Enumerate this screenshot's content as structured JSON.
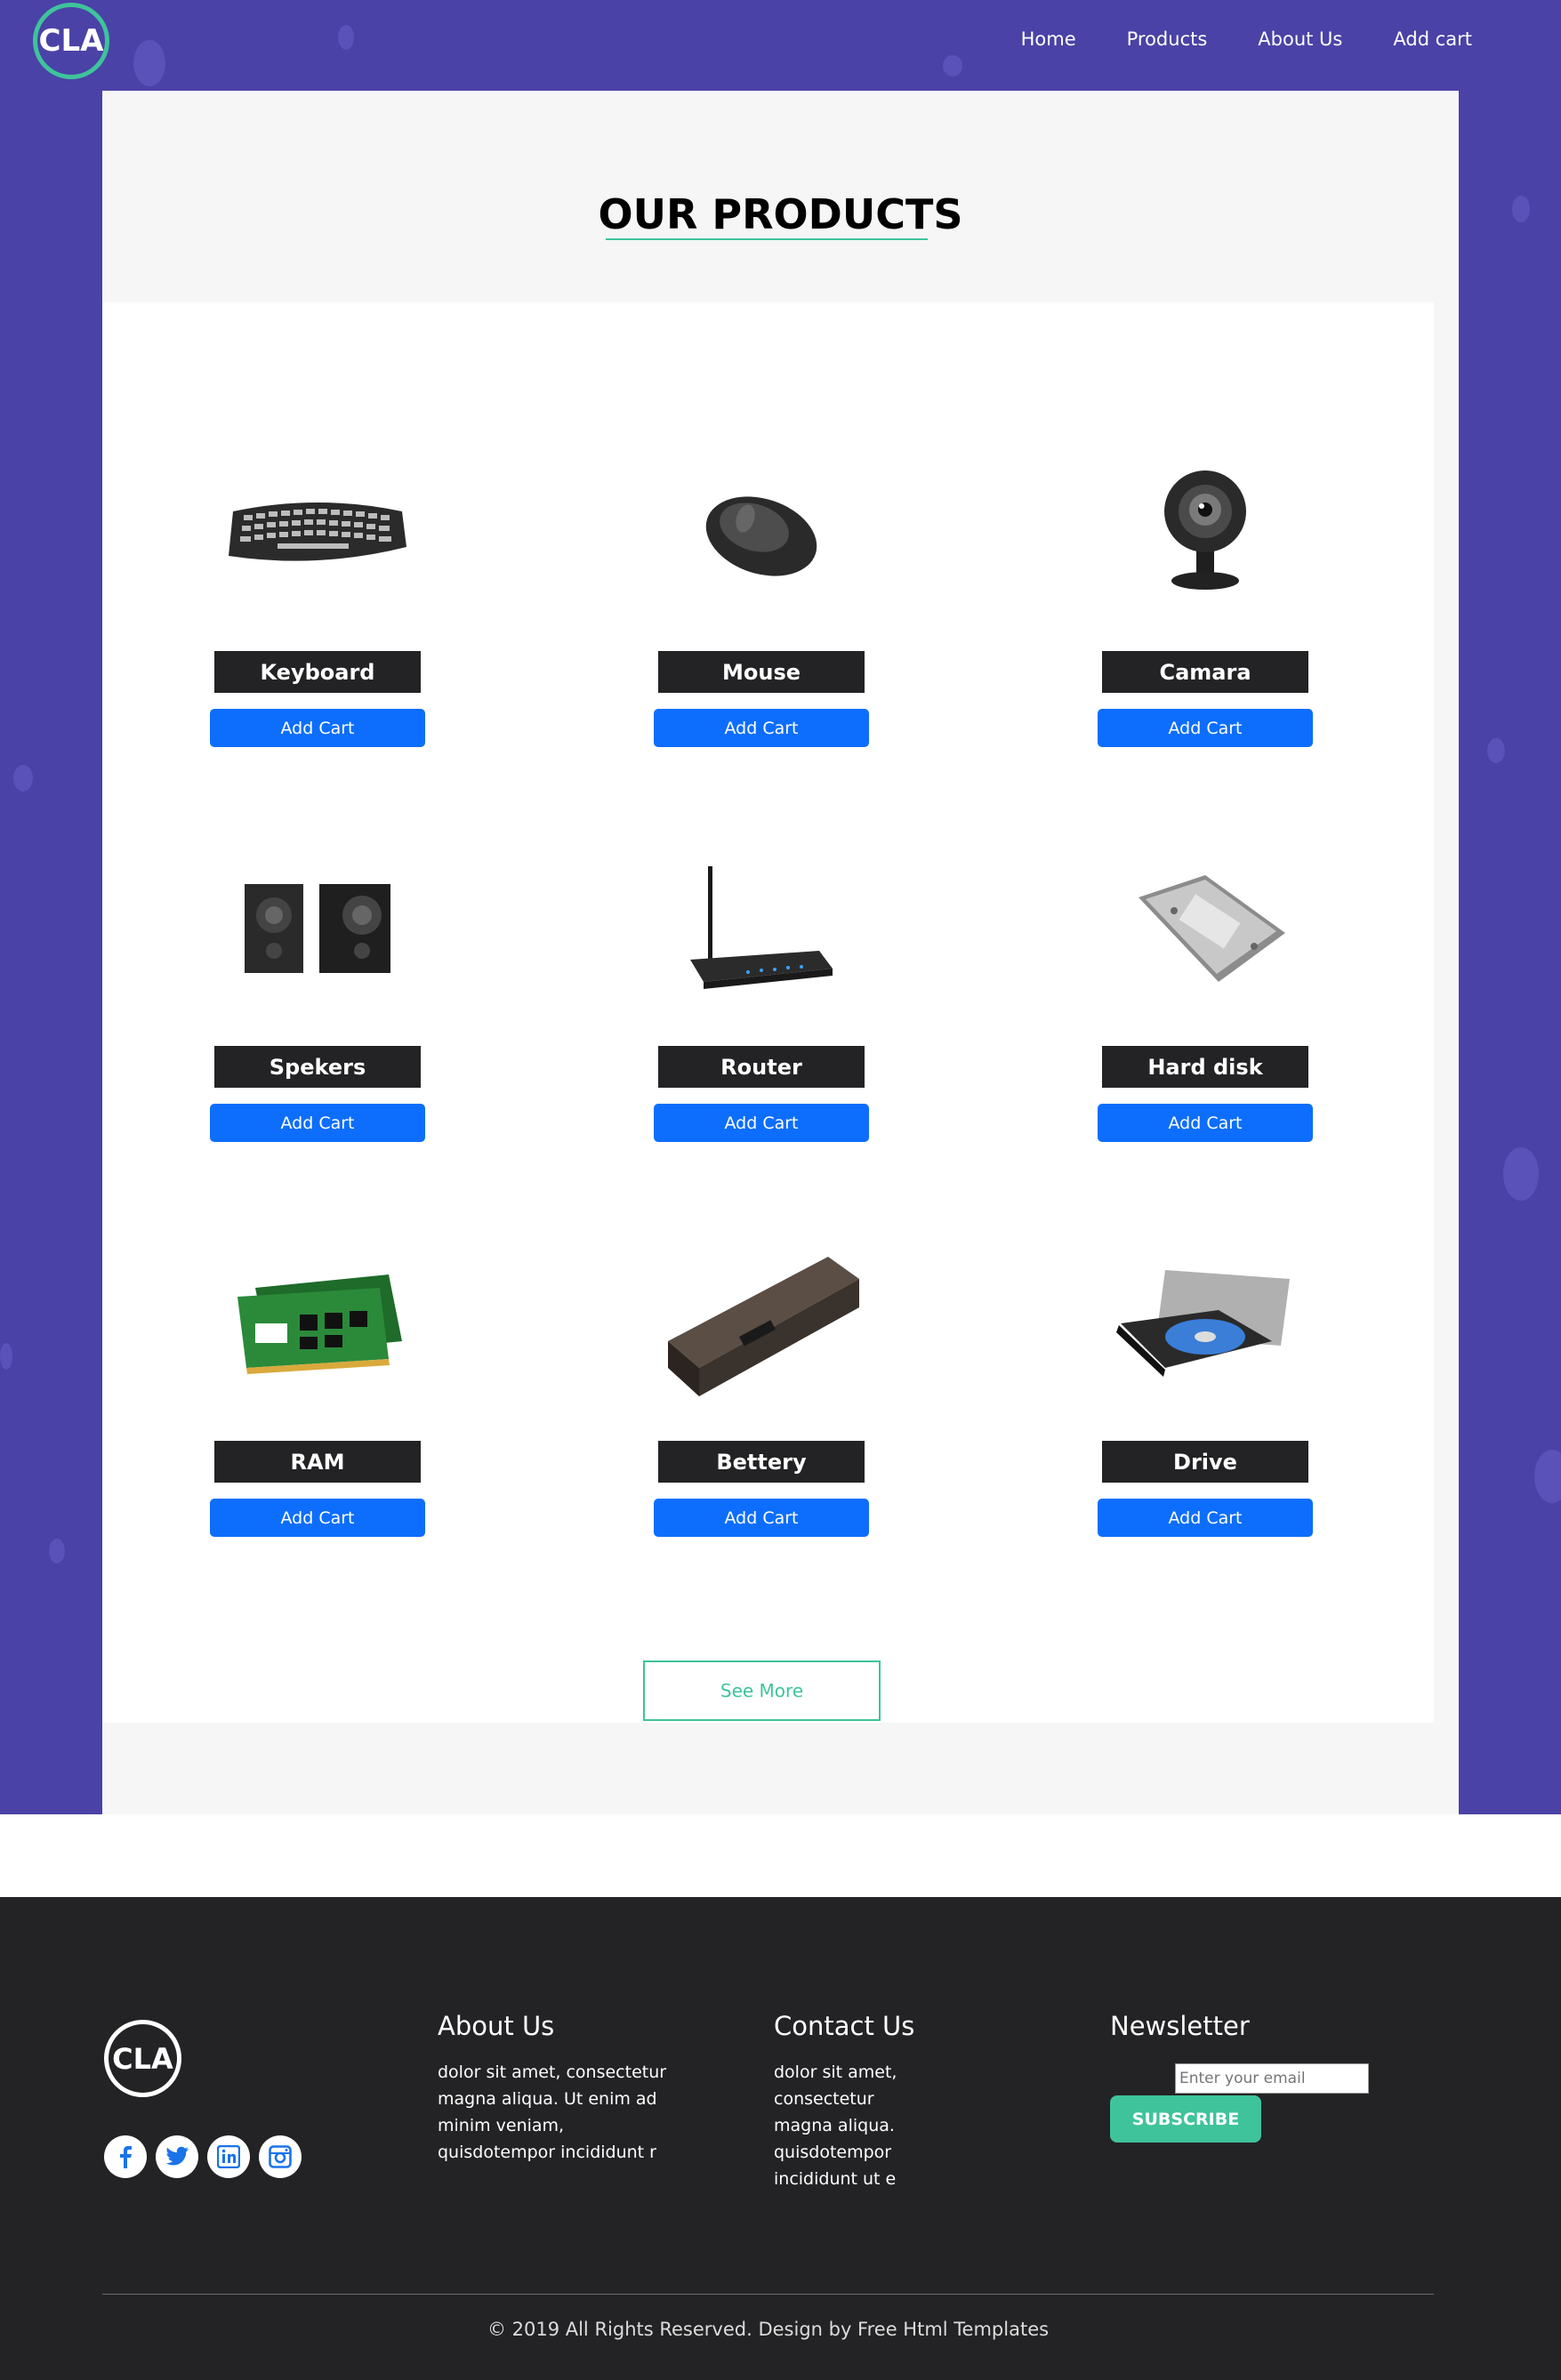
{
  "colors": {
    "header_bg": "#4a42a6",
    "accent": "#3fc39b",
    "button": "#0d6efd",
    "name_label_bg": "#232325",
    "footer_bg": "#232325"
  },
  "header": {
    "logo_text": "CLA",
    "nav": [
      "Home",
      "Products",
      "About Us",
      "Add cart"
    ]
  },
  "main": {
    "title": "OUR PRODUCTS",
    "products": [
      {
        "name": "Keyboard",
        "button": "Add Cart",
        "icon": "keyboard-image"
      },
      {
        "name": "Mouse",
        "button": "Add Cart",
        "icon": "mouse-image"
      },
      {
        "name": "Camara",
        "button": "Add Cart",
        "icon": "webcam-image"
      },
      {
        "name": "Spekers",
        "button": "Add Cart",
        "icon": "speakers-image"
      },
      {
        "name": "Router",
        "button": "Add Cart",
        "icon": "router-image"
      },
      {
        "name": "Hard disk",
        "button": "Add Cart",
        "icon": "hard-disk-image"
      },
      {
        "name": "RAM",
        "button": "Add Cart",
        "icon": "ram-image"
      },
      {
        "name": "Bettery",
        "button": "Add Cart",
        "icon": "battery-image"
      },
      {
        "name": "Drive",
        "button": "Add Cart",
        "icon": "optical-drive-image"
      }
    ],
    "see_more": "See More"
  },
  "footer": {
    "logo_text": "CLA",
    "socials": [
      "facebook-icon",
      "twitter-icon",
      "linkedin-icon",
      "instagram-icon"
    ],
    "about": {
      "title": "About Us",
      "lines": [
        "dolor sit amet, consectetur",
        "magna aliqua. Ut enim ad",
        "minim veniam,",
        "quisdotempor incididunt r"
      ]
    },
    "contact": {
      "title": "Contact Us",
      "lines": [
        "dolor sit amet,",
        "consectetur",
        "magna aliqua.",
        "quisdotempor",
        "incididunt ut e"
      ]
    },
    "newsletter": {
      "title": "Newsletter",
      "placeholder": "Enter your email",
      "button": "SUBSCRIBE"
    },
    "copyright": "© 2019 All Rights Reserved. Design by Free Html Templates"
  }
}
